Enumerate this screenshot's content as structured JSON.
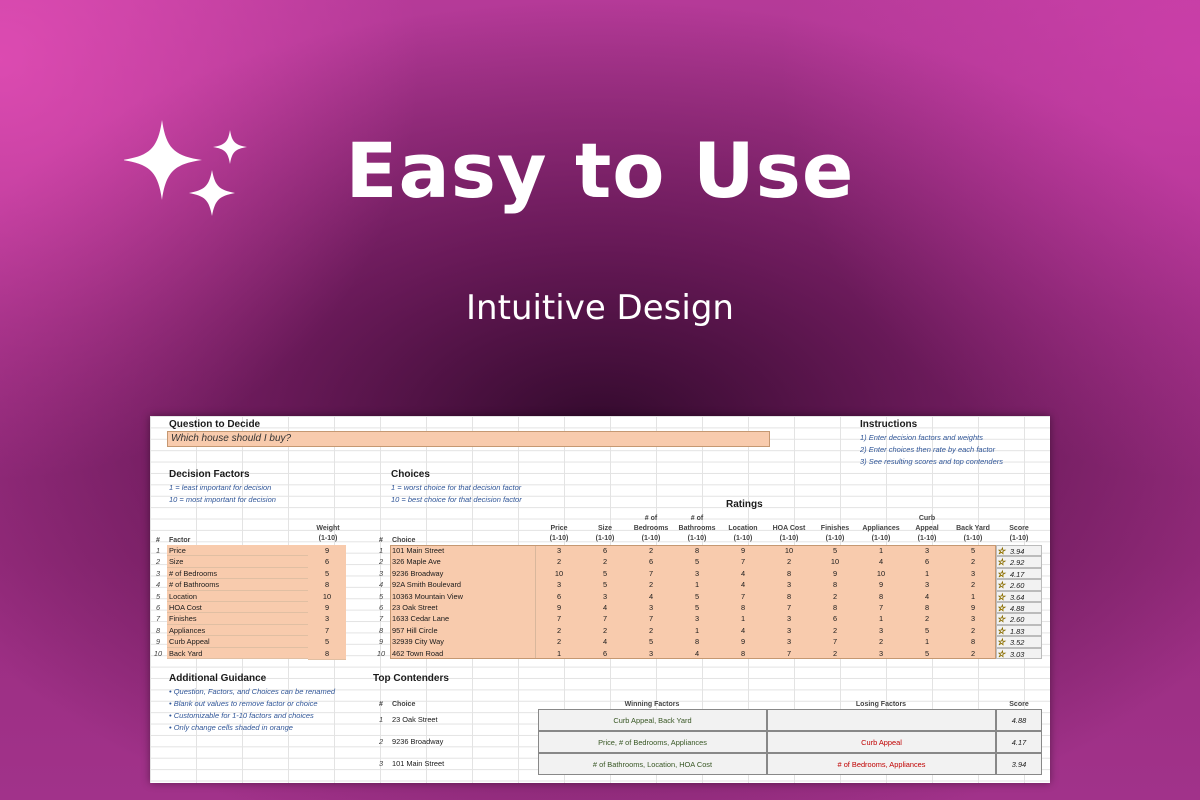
{
  "hero": {
    "title": "Easy to Use",
    "subtitle": "Intuitive Design",
    "sparkle_icon": "sparkles-icon"
  },
  "sheet": {
    "question": {
      "heading": "Question to Decide",
      "value": "Which house should I buy?"
    },
    "instructions": {
      "heading": "Instructions",
      "items": [
        "1) Enter decision factors and weights",
        "2) Enter choices then rate by each factor",
        "3) See resulting scores and top contenders"
      ]
    },
    "factors": {
      "heading": "Decision Factors",
      "note1": "1 = least important for decision",
      "note2": "10 = most important for decision",
      "col_num": "#",
      "col_factor": "Factor",
      "col_weight": "Weight",
      "col_weight2": "(1-10)",
      "rows": [
        {
          "n": "1",
          "name": "Price",
          "w": "9"
        },
        {
          "n": "2",
          "name": "Size",
          "w": "6"
        },
        {
          "n": "3",
          "name": "# of Bedrooms",
          "w": "5"
        },
        {
          "n": "4",
          "name": "# of Bathrooms",
          "w": "8"
        },
        {
          "n": "5",
          "name": "Location",
          "w": "10"
        },
        {
          "n": "6",
          "name": "HOA Cost",
          "w": "9"
        },
        {
          "n": "7",
          "name": "Finishes",
          "w": "3"
        },
        {
          "n": "8",
          "name": "Appliances",
          "w": "7"
        },
        {
          "n": "9",
          "name": "Curb Appeal",
          "w": "5"
        },
        {
          "n": "10",
          "name": "Back Yard",
          "w": "8"
        }
      ]
    },
    "choices": {
      "heading": "Choices",
      "note1": "1 = worst choice for that decision factor",
      "note2": "10 = best choice for that decision factor",
      "ratings_label": "Ratings",
      "col_num": "#",
      "col_choice": "Choice",
      "columns": [
        {
          "l1": "",
          "l2": "Price",
          "l3": "(1-10)"
        },
        {
          "l1": "",
          "l2": "Size",
          "l3": "(1-10)"
        },
        {
          "l1": "# of",
          "l2": "Bedrooms",
          "l3": "(1-10)"
        },
        {
          "l1": "# of",
          "l2": "Bathrooms",
          "l3": "(1-10)"
        },
        {
          "l1": "",
          "l2": "Location",
          "l3": "(1-10)"
        },
        {
          "l1": "",
          "l2": "HOA Cost",
          "l3": "(1-10)"
        },
        {
          "l1": "",
          "l2": "Finishes",
          "l3": "(1-10)"
        },
        {
          "l1": "",
          "l2": "Appliances",
          "l3": "(1-10)"
        },
        {
          "l1": "Curb",
          "l2": "Appeal",
          "l3": "(1-10)"
        },
        {
          "l1": "",
          "l2": "Back Yard",
          "l3": "(1-10)"
        },
        {
          "l1": "",
          "l2": "Score",
          "l3": "(1-10)"
        }
      ],
      "rows": [
        {
          "n": "1",
          "name": "101 Main Street",
          "r": [
            "3",
            "6",
            "2",
            "8",
            "9",
            "10",
            "5",
            "1",
            "3",
            "5"
          ],
          "score": "3.94",
          "fill": 0.5
        },
        {
          "n": "2",
          "name": "326 Maple Ave",
          "r": [
            "2",
            "2",
            "6",
            "5",
            "7",
            "2",
            "10",
            "4",
            "6",
            "2"
          ],
          "score": "2.92",
          "fill": 0.3
        },
        {
          "n": "3",
          "name": "9236 Broadway",
          "r": [
            "10",
            "5",
            "7",
            "3",
            "4",
            "8",
            "9",
            "10",
            "1",
            "3"
          ],
          "score": "4.17",
          "fill": 0.5
        },
        {
          "n": "4",
          "name": "92A Smith Boulevard",
          "r": [
            "3",
            "5",
            "2",
            "1",
            "4",
            "3",
            "8",
            "9",
            "3",
            "2"
          ],
          "score": "2.60",
          "fill": 0.2
        },
        {
          "n": "5",
          "name": "10363 Mountain View",
          "r": [
            "6",
            "3",
            "4",
            "5",
            "7",
            "8",
            "2",
            "8",
            "4",
            "1"
          ],
          "score": "3.64",
          "fill": 0.4
        },
        {
          "n": "6",
          "name": "23 Oak Street",
          "r": [
            "9",
            "4",
            "3",
            "5",
            "8",
            "7",
            "8",
            "7",
            "8",
            "9"
          ],
          "score": "4.88",
          "fill": 0.6
        },
        {
          "n": "7",
          "name": "1633 Cedar Lane",
          "r": [
            "7",
            "7",
            "7",
            "3",
            "1",
            "3",
            "6",
            "1",
            "2",
            "3"
          ],
          "score": "2.60",
          "fill": 0.2
        },
        {
          "n": "8",
          "name": "957 Hill Circle",
          "r": [
            "2",
            "2",
            "2",
            "1",
            "4",
            "3",
            "2",
            "3",
            "5",
            "2"
          ],
          "score": "1.83",
          "fill": 0.0
        },
        {
          "n": "9",
          "name": "32939 City Way",
          "r": [
            "2",
            "4",
            "5",
            "8",
            "9",
            "3",
            "7",
            "2",
            "1",
            "8"
          ],
          "score": "3.52",
          "fill": 0.4
        },
        {
          "n": "10",
          "name": "462 Town Road",
          "r": [
            "1",
            "6",
            "3",
            "4",
            "8",
            "7",
            "2",
            "3",
            "5",
            "2"
          ],
          "score": "3.03",
          "fill": 0.3
        }
      ]
    },
    "guidance": {
      "heading": "Additional Guidance",
      "items": [
        "• Question, Factors, and Choices can be renamed",
        "• Blank out values to remove factor or choice",
        "• Customizable for 1-10 factors and choices",
        "• Only change cells shaded in orange"
      ]
    },
    "top": {
      "heading": "Top Contenders",
      "col_num": "#",
      "col_choice": "Choice",
      "col_win": "Winning Factors",
      "col_lose": "Losing Factors",
      "col_score": "Score",
      "rows": [
        {
          "n": "1",
          "name": "23 Oak Street",
          "win": "Curb Appeal, Back Yard",
          "lose": "",
          "score": "4.88"
        },
        {
          "n": "2",
          "name": "9236 Broadway",
          "win": "Price, # of Bedrooms, Appliances",
          "lose": "Curb Appeal",
          "score": "4.17"
        },
        {
          "n": "3",
          "name": "101 Main Street",
          "win": "# of Bathrooms, Location, HOA Cost",
          "lose": "# of Bedrooms, Appliances",
          "score": "3.94"
        }
      ]
    }
  }
}
